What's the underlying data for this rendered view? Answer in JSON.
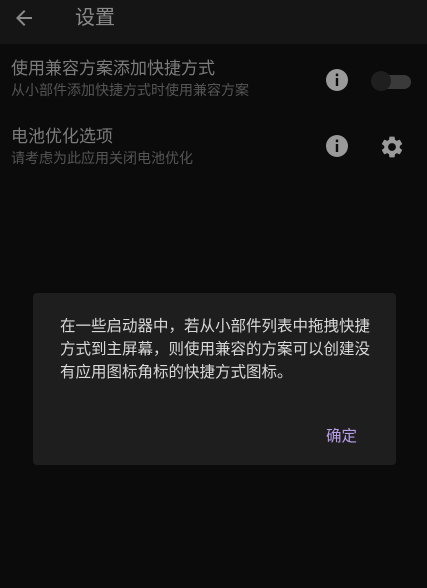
{
  "appbar": {
    "title": "设置",
    "back_icon": "arrow-back-icon"
  },
  "settings": [
    {
      "title": "使用兼容方案添加快捷方式",
      "summary": "从小部件添加快捷方式时使用兼容方案",
      "info_icon": "info-icon",
      "control": "toggle",
      "toggle_on": false
    },
    {
      "title": "电池优化选项",
      "summary": "请考虑为此应用关闭电池优化",
      "info_icon": "info-icon",
      "control": "gear-icon"
    }
  ],
  "dialog": {
    "message": "在一些启动器中，若从小部件列表中拖拽快捷方式到主屏幕，则使用兼容的方案可以创建没有应用图标角标的快捷方式图标。",
    "ok_label": "确定"
  },
  "colors": {
    "background": "#0b0b0b",
    "appbar": "#151515",
    "dialog_background": "#1e1e1e",
    "accent": "#b89ee6",
    "dimmed_text": "#7c7c7c"
  }
}
